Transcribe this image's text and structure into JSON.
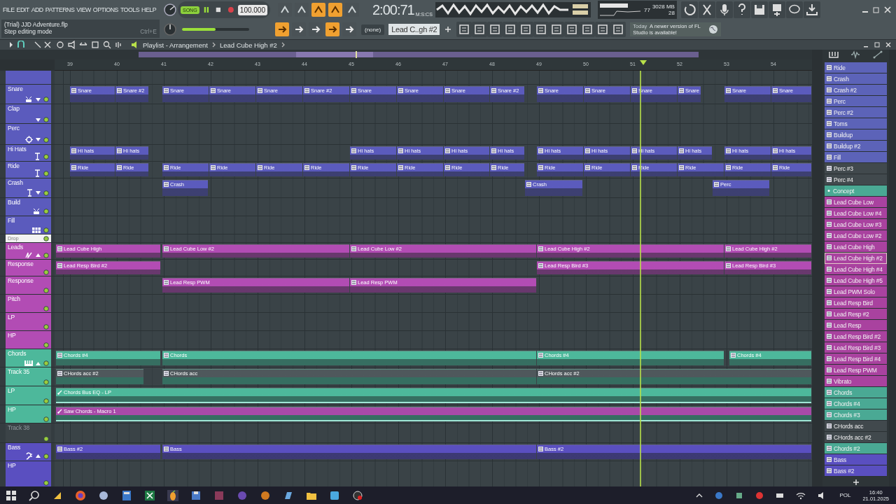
{
  "menu": [
    "FILE",
    "EDIT",
    "ADD",
    "PATTERNS",
    "VIEW",
    "OPTIONS",
    "TOOLS",
    "HELP"
  ],
  "hint": {
    "title": "(Trial) JJD Adventure.flp",
    "text": "Step editing mode",
    "shortcut": "Ctrl+E"
  },
  "transport": {
    "mode_label": "SONG",
    "song": true,
    "tempo": "100.000",
    "time": "2:00:71",
    "time_unit": "M:S:CS"
  },
  "master_volume": {
    "level": 0.5
  },
  "snap_toggles_top": [
    {
      "on": false
    },
    {
      "on": false
    },
    {
      "on": true
    },
    {
      "on": true
    },
    {
      "on": false
    }
  ],
  "snap_toggles_bottom": [
    {
      "on": true
    },
    {
      "on": false
    },
    {
      "on": false
    },
    {
      "on": true
    },
    {
      "on": false
    }
  ],
  "cpu": {
    "cpu": "77",
    "memory": "3028 MB",
    "polyphony": "28"
  },
  "snap": "(none)",
  "pattern_selector": "Lead C..gh #2",
  "news": {
    "when": "Today",
    "text": "A newer version of FL Studio is available!"
  },
  "playlist": {
    "title": "Playlist - Arrangement",
    "pattern": "Lead Cube High #2",
    "ruler": [
      "39",
      "40",
      "41",
      "42",
      "43",
      "44",
      "45",
      "46",
      "47",
      "48",
      "49",
      "50",
      "51",
      "52",
      "53",
      "54"
    ],
    "tracks": [
      {
        "color": "#5b5bbd"
      },
      {
        "name": "Snare",
        "color": "#5b5bbd",
        "clips": [
          {
            "label": "Snare"
          },
          {
            "label": "Snare #2"
          },
          {
            "label": "Snare"
          },
          {
            "label": "Snare"
          },
          {
            "label": "Snare"
          },
          {
            "label": "Snare #2"
          },
          {
            "label": "Snare"
          },
          {
            "label": "Snare"
          },
          {
            "label": "Snare"
          },
          {
            "label": "Snare #2"
          },
          {
            "label": "Snare"
          },
          {
            "label": "Snare"
          },
          {
            "label": "Snare"
          },
          {
            "label": "Snare"
          },
          {
            "label": "Snare"
          },
          {
            "label": "Snare"
          }
        ]
      },
      {
        "name": "Clap",
        "color": "#5b5bbd"
      },
      {
        "name": "Perc",
        "color": "#5b5bbd"
      },
      {
        "name": "Hi Hats",
        "color": "#5b5bbd",
        "clips": [
          {
            "label": "Hi hats"
          },
          {
            "label": "Hi hats"
          },
          {
            "label": "Hi hats"
          },
          {
            "label": "Hi hats"
          },
          {
            "label": "Hi hats"
          },
          {
            "label": "Hi hats"
          },
          {
            "label": "Hi hats"
          },
          {
            "label": "Hi hats"
          },
          {
            "label": "Hi hats"
          },
          {
            "label": "Hi hats"
          },
          {
            "label": "Hi hats"
          },
          {
            "label": "Hi hats"
          }
        ]
      },
      {
        "name": "Ride",
        "color": "#5b5bbd",
        "clips": [
          {
            "label": "Ride"
          },
          {
            "label": "Ride"
          },
          {
            "label": "Ride"
          },
          {
            "label": "Ride"
          },
          {
            "label": "Ride"
          },
          {
            "label": "Ride"
          },
          {
            "label": "Ride"
          },
          {
            "label": "Ride"
          },
          {
            "label": "Ride"
          },
          {
            "label": "Ride"
          },
          {
            "label": "Ride"
          },
          {
            "label": "Ride"
          },
          {
            "label": "Ride"
          },
          {
            "label": "Ride"
          },
          {
            "label": "Ride"
          },
          {
            "label": "Ride"
          }
        ]
      },
      {
        "name": "Crash",
        "color": "#5b5bbd",
        "clips": [
          {
            "label": "Crash"
          },
          {
            "label": "Crash"
          },
          {
            "label": "Perc"
          }
        ]
      },
      {
        "name": "Build",
        "color": "#5b5bbd"
      },
      {
        "name": "Fill",
        "color": "#5b5bbd"
      },
      {
        "name": "Drop",
        "kind": "divider",
        "color": "#f2f2f2"
      },
      {
        "name": "Leads",
        "color": "#b24cb4",
        "clips": [
          {
            "label": "Lead Cube High"
          },
          {
            "label": "Lead Cube Low #2"
          },
          {
            "label": "Lead Cube Low #2"
          },
          {
            "label": "Lead Cube High #2"
          },
          {
            "label": "Lead Cube High #2"
          }
        ]
      },
      {
        "name": "Response",
        "color": "#b24cb4",
        "clips": [
          {
            "label": "Lead Resp Bird #2"
          },
          {
            "label": "Lead Resp Bird #3"
          },
          {
            "label": "Lead Resp Bird #3"
          }
        ]
      },
      {
        "name": "Response",
        "color": "#b24cb4",
        "clips": [
          {
            "label": "Lead Resp PWM"
          },
          {
            "label": "Lead Resp PWM"
          }
        ]
      },
      {
        "name": "Pitch",
        "color": "#b24cb4"
      },
      {
        "name": "LP",
        "color": "#b24cb4"
      },
      {
        "name": "HP",
        "color": "#b24cb4"
      },
      {
        "name": "Chords",
        "color": "#4db89b",
        "clips": [
          {
            "label": "Chords #4"
          },
          {
            "label": "Chords"
          },
          {
            "label": "Chords #4"
          },
          {
            "label": "Chords #4"
          }
        ]
      },
      {
        "name": "Track 35",
        "color": "#4db89b",
        "clips": [
          {
            "label": "CHords acc #2",
            "color": "#4f585c"
          },
          {
            "label": "CHords acc",
            "color": "#4f585c"
          },
          {
            "label": "CHords acc #2",
            "color": "#4f585c"
          }
        ]
      },
      {
        "name": "LP",
        "color": "#4db89b",
        "clips": [
          {
            "label": "Chords Bus EQ - LP",
            "kind": "automation"
          }
        ]
      },
      {
        "name": "HP",
        "color": "#4db89b",
        "clips": [
          {
            "label": "Saw Chords - Macro 1",
            "kind": "automation",
            "color": "#a84aa8"
          }
        ]
      },
      {
        "name": "Track 38",
        "color": "#3b4347",
        "muted": true
      },
      {
        "name": "Bass",
        "color": "#5a4fc0",
        "clips": [
          {
            "label": "Bass #2"
          },
          {
            "label": "Bass"
          },
          {
            "label": "Bass #2"
          }
        ]
      },
      {
        "name": "HP",
        "color": "#5a4fc0"
      }
    ]
  },
  "patterns": [
    {
      "name": "Ride",
      "color": "#5c63b8",
      "selected": false
    },
    {
      "name": "Crash",
      "color": "#5c63b8",
      "selected": false
    },
    {
      "name": "Crash #2",
      "color": "#5c63b8",
      "selected": false
    },
    {
      "name": "Perc",
      "color": "#5c63b8",
      "selected": false
    },
    {
      "name": "Perc #2",
      "color": "#5c63b8",
      "selected": false
    },
    {
      "name": "Toms",
      "color": "#5c63b8",
      "selected": false
    },
    {
      "name": "Buildup",
      "color": "#5c63b8",
      "selected": false
    },
    {
      "name": "Buildup #2",
      "color": "#5c63b8",
      "selected": false
    },
    {
      "name": "Fill",
      "color": "#5c63b8",
      "selected": false
    },
    {
      "name": "Perc #3",
      "color": "#41494d",
      "selected": false
    },
    {
      "name": "Perc #4",
      "color": "#41494d",
      "selected": false
    },
    {
      "name": "Concept",
      "color": "#4aa994",
      "selected": false,
      "kind": "marker"
    },
    {
      "name": "Lead Cube Low",
      "color": "#a9429f",
      "selected": false
    },
    {
      "name": "Lead Cube Low #4",
      "color": "#a9429f",
      "selected": false
    },
    {
      "name": "Lead Cube Low #3",
      "color": "#a9429f",
      "selected": false
    },
    {
      "name": "Lead Cube Low #2",
      "color": "#a9429f",
      "selected": false
    },
    {
      "name": "Lead Cube High",
      "color": "#a9429f",
      "selected": false
    },
    {
      "name": "Lead Cube High #2",
      "color": "#a9429f",
      "selected": true
    },
    {
      "name": "Lead Cube High #4",
      "color": "#a9429f",
      "selected": false
    },
    {
      "name": "Lead Cube High #5",
      "color": "#a9429f",
      "selected": false
    },
    {
      "name": "Lead PWM Solo",
      "color": "#a9429f",
      "selected": false
    },
    {
      "name": "Lead Resp Bird",
      "color": "#a9429f",
      "selected": false
    },
    {
      "name": "Lead Resp #2",
      "color": "#a9429f",
      "selected": false
    },
    {
      "name": "Lead Resp",
      "color": "#a9429f",
      "selected": false
    },
    {
      "name": "Lead Resp Bird #2",
      "color": "#a9429f",
      "selected": false
    },
    {
      "name": "Lead Resp Bird #3",
      "color": "#a9429f",
      "selected": false
    },
    {
      "name": "Lead Resp Bird #4",
      "color": "#a9429f",
      "selected": false
    },
    {
      "name": "Lead Resp PWM",
      "color": "#a9429f",
      "selected": false
    },
    {
      "name": "Vibrato",
      "color": "#a9429f",
      "selected": false
    },
    {
      "name": "Chords",
      "color": "#4aa994",
      "selected": false
    },
    {
      "name": "Chords #4",
      "color": "#4aa994",
      "selected": false
    },
    {
      "name": "Chords #3",
      "color": "#4aa994",
      "selected": false
    },
    {
      "name": "CHords acc",
      "color": "#41494d",
      "selected": false
    },
    {
      "name": "CHords acc #2",
      "color": "#41494d",
      "selected": false
    },
    {
      "name": "Chords #2",
      "color": "#4aa994",
      "selected": false
    },
    {
      "name": "Bass",
      "color": "#5a4fc0",
      "selected": false
    },
    {
      "name": "Bass #2",
      "color": "#5a4fc0",
      "selected": false
    }
  ],
  "taskbar": {
    "language": "POL",
    "time": "16:40",
    "date": "21.01.2025"
  }
}
